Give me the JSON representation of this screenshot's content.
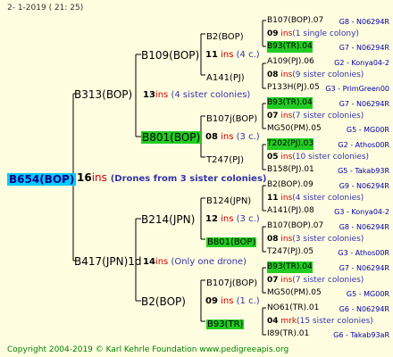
{
  "header": {
    "top_line": "2-   1-2019  ( 21:  25)"
  },
  "footer": {
    "copyright": "Copyright 2004-2019 © Karl Kehrle Foundation    www.pedigreeapis.org"
  },
  "root": {
    "label": "B654(BOP)",
    "count": "16",
    "ins": "ins",
    "desc": "(Drones from 3 sister colonies)"
  },
  "gen1": [
    {
      "label": "B313(BOP)",
      "count": "13",
      "ins": "ins",
      "desc": "(4 sister colonies)"
    },
    {
      "label": "B417(JPN)1d",
      "count": "14",
      "ins": "ins",
      "desc": "(Only one drone)"
    }
  ],
  "gen2": [
    {
      "label": "B109(BOP)",
      "count": "11",
      "ins": "ins",
      "desc": "(4 c.)"
    },
    {
      "label": "B801(BOP)",
      "count": "08",
      "ins": "ins",
      "desc": "(3 c.)"
    },
    {
      "label": "B214(JPN)",
      "count": "12",
      "ins": "ins",
      "desc": "(3 c.)"
    },
    {
      "label": "B2(BOP)",
      "count": "09",
      "ins": "ins",
      "desc": "(1 c.)"
    }
  ],
  "gen3": [
    {
      "label": "B2(BOP)"
    },
    {
      "label": "A141(PJ)",
      "count": "11",
      "ins": "ins",
      "desc": "(4 c.)"
    },
    {
      "label": "B107j(BOP)"
    },
    {
      "label": "T247(PJ)",
      "count": "08",
      "ins": "ins",
      "desc": "(3 c.)"
    },
    {
      "label": "B124(JPN)"
    },
    {
      "label": "B801(BOP)",
      "count": "12",
      "ins": "ins",
      "desc": "(3 c.)"
    },
    {
      "label": "B107j(BOP)"
    },
    {
      "label": "B93(TR)",
      "count": "09",
      "ins": "ins",
      "desc": "(1 c.)"
    }
  ],
  "gen4": [
    {
      "father": "B107(BOP).07",
      "father_codes": "G8 - N06294R",
      "count": "09",
      "ins": "ins",
      "desc": "(1 single colony)",
      "mother": "B93(TR).04",
      "mother_codes": "G7 - N06294R"
    },
    {
      "father": "A109(PJ).06",
      "father_codes": "G2 - Konya04-2",
      "count": "08",
      "ins": "ins",
      "desc": "(9 sister colonies)",
      "mother": "P133H(PJ).05",
      "mother_codes": "G3 - PrimGreen00"
    },
    {
      "father": "B93(TR).04",
      "father_codes": "G7 - N06294R",
      "count": "07",
      "ins": "ins",
      "desc": "(7 sister colonies)",
      "mother": "MG50(PM).05",
      "mother_codes": "G5 - MG00R"
    },
    {
      "father": "T202(PJ).03",
      "father_codes": "G2 - Athos00R",
      "count": "05",
      "ins": "ins",
      "desc": "(10 sister colonies)",
      "mother": "B158(PJ).01",
      "mother_codes": "G5 - Takab93R"
    },
    {
      "father": "B2(BOP).09",
      "father_codes": "G9 - N06294R",
      "count": "11",
      "ins": "ins",
      "desc": "(4 sister colonies)",
      "mother": "A141(PJ).08",
      "mother_codes": "G3 - Konya04-2"
    },
    {
      "father": "B107(BOP).07",
      "father_codes": "G8 - N06294R",
      "count": "08",
      "ins": "ins",
      "desc": "(3 sister colonies)",
      "mother": "T247(PJ).05",
      "mother_codes": "G3 - Athos00R"
    },
    {
      "father": "B93(TR).04",
      "father_codes": "G7 - N06294R",
      "count": "07",
      "ins": "ins",
      "desc": "(7 sister colonies)",
      "mother": "MG50(PM).05",
      "mother_codes": "G5 - MG00R"
    },
    {
      "father": "NO61(TR).01",
      "father_codes": "G6 - N06294R",
      "count": "04",
      "ins": "mrk",
      "desc": "(15 sister colonies)",
      "mother": "I89(TR).01",
      "mother_codes": "G6 - Takab93aR"
    }
  ],
  "colors": {
    "background": "#fffde0",
    "highlight_green": "#22cc22",
    "highlight_cyan": "#00ccff",
    "ins_red": "#cc0000",
    "code_blue": "#0000aa"
  }
}
